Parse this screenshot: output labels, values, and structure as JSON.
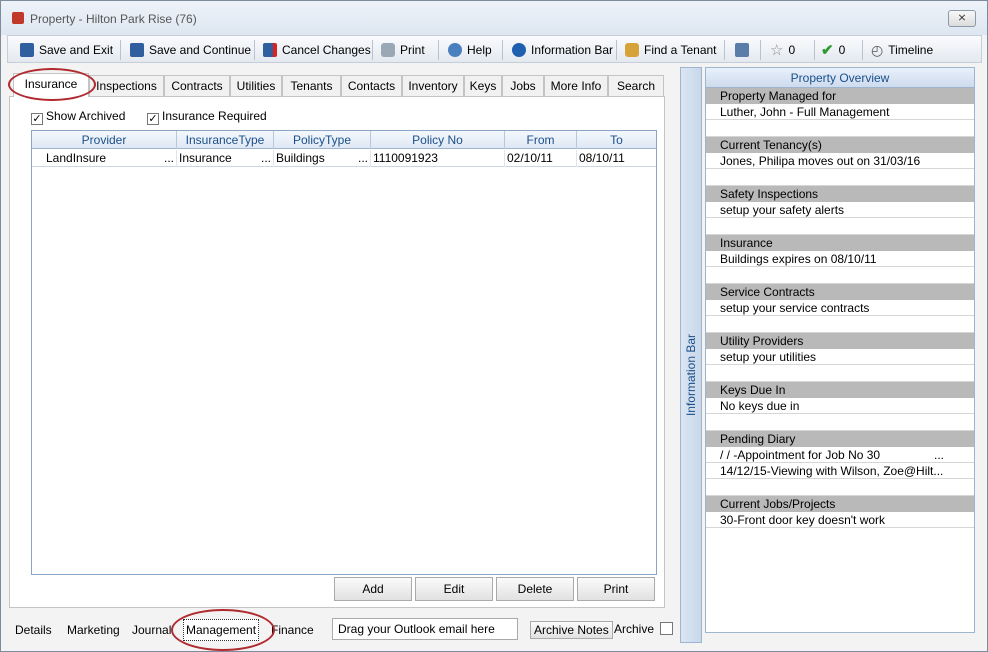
{
  "window": {
    "title": "Property  - Hilton Park Rise (76)",
    "close_label": "⨯"
  },
  "toolbar": {
    "save_exit": "Save and Exit",
    "save_continue": "Save and Continue",
    "cancel": "Cancel Changes",
    "print": "Print",
    "help": "Help",
    "info_bar": "Information Bar",
    "find_tenant": "Find a Tenant",
    "star_count": "0",
    "check_count": "0",
    "timeline": "Timeline"
  },
  "tabs": [
    "Insurance",
    "Inspections",
    "Contracts",
    "Utilities",
    "Tenants",
    "Contacts",
    "Inventory",
    "Keys",
    "Jobs",
    "More Info",
    "Search"
  ],
  "options": {
    "show_archived": "Show Archived",
    "insurance_required": "Insurance Required",
    "show_archived_checked": true,
    "insurance_required_checked": true
  },
  "grid": {
    "headers": [
      "Provider",
      "InsuranceType",
      "PolicyType",
      "Policy No",
      "From",
      "To"
    ],
    "rows": [
      [
        "LandInsure",
        "Insurance",
        "Buildings",
        "1110091923",
        "02/10/11",
        "08/10/11"
      ]
    ],
    "ellipsis": "..."
  },
  "grid_buttons": {
    "add": "Add",
    "edit": "Edit",
    "delete": "Delete",
    "print": "Print"
  },
  "bottom_tabs": [
    "Details",
    "Marketing",
    "Journal",
    "Management",
    "Finance"
  ],
  "bottom": {
    "drag_placeholder": "Drag your Outlook email here",
    "archive_notes": "Archive Notes",
    "archive": "Archive"
  },
  "info_bar_label": "Information Bar",
  "overview": {
    "title": "Property Overview",
    "sections": [
      {
        "heading": "Property Managed for",
        "rows": [
          "Luther, John - Full Management"
        ]
      },
      {
        "heading": "Current Tenancy(s)",
        "rows": [
          "Jones, Philipa moves out on 31/03/16"
        ]
      },
      {
        "heading": "Safety Inspections",
        "rows": [
          "setup your safety alerts"
        ]
      },
      {
        "heading": "Insurance",
        "rows": [
          "Buildings expires on 08/10/11"
        ]
      },
      {
        "heading": "Service Contracts",
        "rows": [
          "setup your service contracts"
        ]
      },
      {
        "heading": "Utility Providers",
        "rows": [
          "setup your utilities"
        ]
      },
      {
        "heading": "Keys Due In",
        "rows": [
          "No keys due in"
        ]
      },
      {
        "heading": "Pending Diary",
        "rows": [
          " /  / -Appointment for Job No 30",
          "14/12/15-Viewing with Wilson, Zoe@Hilt..."
        ]
      },
      {
        "heading": "Current Jobs/Projects",
        "rows": [
          "30-Front door key doesn't work"
        ]
      }
    ]
  },
  "colors": {
    "accent": "#1b4f8a",
    "highlight_ring": "#b02a30",
    "section_bg": "#b9b9b9"
  }
}
